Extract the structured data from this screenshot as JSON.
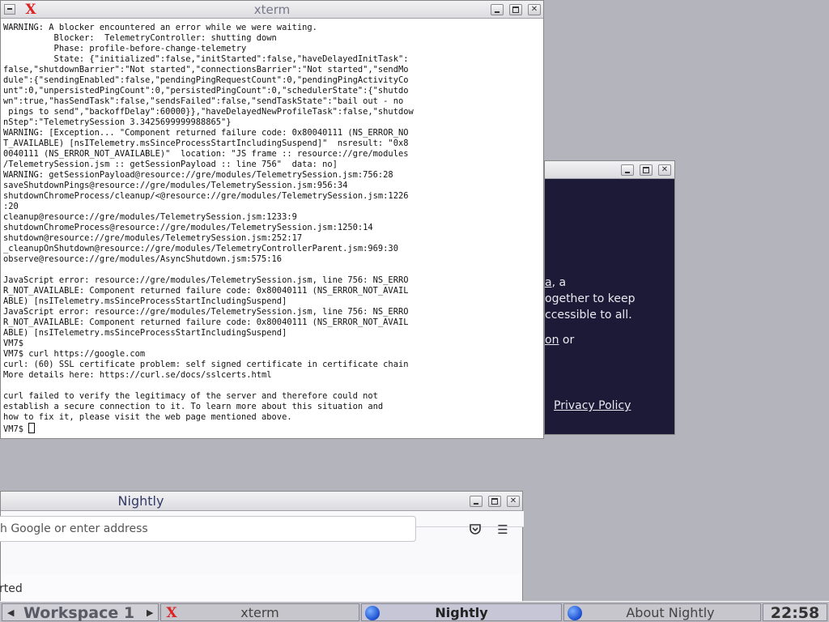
{
  "desktop": {
    "background": "#b4b4bc"
  },
  "xterm": {
    "title": "xterm",
    "lines": [
      "WARNING: A blocker encountered an error while we were waiting.",
      "          Blocker:  TelemetryController: shutting down",
      "          Phase: profile-before-change-telemetry",
      "          State: {\"initialized\":false,\"initStarted\":false,\"haveDelayedInitTask\":",
      "false,\"shutdownBarrier\":\"Not started\",\"connectionsBarrier\":\"Not started\",\"sendMo",
      "dule\":{\"sendingEnabled\":false,\"pendingPingRequestCount\":0,\"pendingPingActivityCo",
      "unt\":0,\"unpersistedPingCount\":0,\"persistedPingCount\":0,\"schedulerState\":{\"shutdo",
      "wn\":true,\"hasSendTask\":false,\"sendsFailed\":false,\"sendTaskState\":\"bail out - no",
      " pings to send\",\"backoffDelay\":60000}},\"haveDelayedNewProfileTask\":false,\"shutdow",
      "nStep\":\"TelemetrySession 3.3425699999988865\"}",
      "WARNING: [Exception... \"Component returned failure code: 0x80040111 (NS_ERROR_NO",
      "T_AVAILABLE) [nsITelemetry.msSinceProcessStartIncludingSuspend]\"  nsresult: \"0x8",
      "0040111 (NS_ERROR_NOT_AVAILABLE)\"  location: \"JS frame :: resource://gre/modules",
      "/TelemetrySession.jsm :: getSessionPayload :: line 756\"  data: no]",
      "WARNING: getSessionPayload@resource://gre/modules/TelemetrySession.jsm:756:28",
      "saveShutdownPings@resource://gre/modules/TelemetrySession.jsm:956:34",
      "shutdownChromeProcess/cleanup/<@resource://gre/modules/TelemetrySession.jsm:1226",
      ":20",
      "cleanup@resource://gre/modules/TelemetrySession.jsm:1233:9",
      "shutdownChromeProcess@resource://gre/modules/TelemetrySession.jsm:1250:14",
      "shutdown@resource://gre/modules/TelemetrySession.jsm:252:17",
      "_cleanupOnShutdown@resource://gre/modules/TelemetryControllerParent.jsm:969:30",
      "observe@resource://gre/modules/AsyncShutdown.jsm:575:16",
      "",
      "JavaScript error: resource://gre/modules/TelemetrySession.jsm, line 756: NS_ERRO",
      "R_NOT_AVAILABLE: Component returned failure code: 0x80040111 (NS_ERROR_NOT_AVAIL",
      "ABLE) [nsITelemetry.msSinceProcessStartIncludingSuspend]",
      "JavaScript error: resource://gre/modules/TelemetrySession.jsm, line 756: NS_ERRO",
      "R_NOT_AVAILABLE: Component returned failure code: 0x80040111 (NS_ERROR_NOT_AVAIL",
      "ABLE) [nsITelemetry.msSinceProcessStartIncludingSuspend]",
      "VM7$",
      "VM7$ curl https://google.com",
      "curl: (60) SSL certificate problem: self signed certificate in certificate chain",
      "More details here: https://curl.se/docs/sslcerts.html",
      "",
      "curl failed to verify the legitimacy of the server and therefore could not",
      "establish a secure connection to it. To learn more about this situation and",
      "how to fix it, please visit the web page mentioned above."
    ],
    "prompt": "VM7$ "
  },
  "about_window": {
    "title": "",
    "text_line1_link": "a",
    "text_line1_rest": ", a",
    "text_line2": "ogether to keep",
    "text_line3": "ccessible to all.",
    "text_line4_link": "on",
    "text_line4_rest": " or",
    "privacy_link": "Privacy Policy"
  },
  "nightly": {
    "title": "Nightly",
    "url_placeholder": "h Google or enter address",
    "content_text": "rted",
    "pocket_icon": "pocket-icon",
    "menu_icon": "hamburger-menu-icon"
  },
  "taskbar": {
    "workspace": "Workspace 1",
    "tasks": [
      {
        "label": "xterm",
        "icon": "xterm-icon",
        "active": false
      },
      {
        "label": "Nightly",
        "icon": "nightly-globe-icon",
        "active": true
      },
      {
        "label": "About Nightly",
        "icon": "nightly-globe-icon",
        "active": false
      }
    ],
    "clock": "22:58"
  }
}
